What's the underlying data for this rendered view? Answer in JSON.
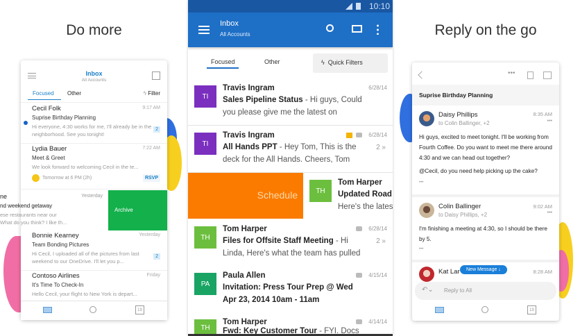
{
  "headings": {
    "left": "Do more",
    "right": "Reply on the go"
  },
  "colors": {
    "outlook_blue": "#1e6fc6",
    "archive_green": "#13b04b",
    "schedule_orange": "#fb7b00",
    "purple": "#7b2fbf",
    "green_avatar": "#6cbf3e",
    "teal_avatar": "#19a463"
  },
  "left_phone": {
    "header": {
      "title": "Inbox",
      "subtitle": "All Accounts",
      "menu_icon": "hamburger-icon",
      "compose_icon": "compose-icon"
    },
    "tabs": [
      {
        "label": "Focused",
        "active": true
      },
      {
        "label": "Other"
      }
    ],
    "filter_label": "Filter",
    "messages": [
      {
        "sender": "Cecil Folk",
        "time": "9:17 AM",
        "subject": "Suprise Birthday Planning",
        "preview": "Hi everyone, 4:30 works for me, I'll already be in the neighborhood. See you tonight!",
        "count": "2",
        "unread": true
      },
      {
        "sender": "Lydia Bauer",
        "time": "7:22 AM",
        "subject": "Meet & Greet",
        "preview": "We look forward to welcoming Cecil in the te...",
        "event": "Tomorrow at 6 PM (2h)",
        "action": "RSVP"
      },
      {
        "sender": "ne",
        "time": "Yesterday",
        "subject": "nd weekend getaway",
        "preview": "ese restaurants near our\nWhat do you think? I like th...",
        "swipe_action": "Archive"
      },
      {
        "sender": "Bonnie Kearney",
        "time": "Yesterday",
        "subject": "Team Bonding Pictures",
        "preview": "Hi Cecil, I uploaded all of the pictures from last weekend to our OneDrive. I'll let you p...",
        "count": "2"
      },
      {
        "sender": "Contoso Airlines",
        "time": "Friday",
        "subject": "It's Time To Check-In",
        "preview": "Hello Cecil, your flight to New York is depart..."
      }
    ],
    "nav": {
      "calendar_day": "19"
    }
  },
  "center_phone": {
    "status": {
      "time": "10:10"
    },
    "header": {
      "title": "Inbox",
      "subtitle": "All Accounts"
    },
    "tabs": [
      {
        "label": "Focused",
        "active": true
      },
      {
        "label": "Other"
      }
    ],
    "quick_filters": "Quick Filters",
    "messages": [
      {
        "initials": "TI",
        "sender": "Travis Ingram",
        "subject": "Sales Pipeline Status",
        "preview1": " - Hi guys, Could",
        "preview2": "you please give me the latest on",
        "date": "6/28/14"
      },
      {
        "initials": "TI",
        "sender": "Travis Ingram",
        "subject": "All Hands PPT",
        "preview1": " - Hey Tom, This is the",
        "preview2": "deck for the All Hands. Cheers, Tom",
        "date": "6/28/14",
        "count": "2",
        "flagged": true
      },
      {
        "initials": "TH",
        "sender": "Tom Harper",
        "subject": "Updated Road",
        "preview2": "Here's the lates",
        "swipe_action": "Schedule"
      },
      {
        "initials": "TH",
        "sender": "Tom Harper",
        "subject": "Files for Offsite Staff Meeting",
        "preview1": " - Hi",
        "preview2": "Linda, Here's what the team has pulled",
        "date": "6/28/14",
        "count": "2"
      },
      {
        "initials": "PA",
        "sender": "Paula Allen",
        "subject": "Invitation: Press Tour Prep @ Wed",
        "preview2": "Apr 23, 2014 10am - 11am",
        "date": "4/15/14"
      },
      {
        "initials": "TH",
        "sender": "Tom Harper",
        "subject": "Fwd: Key Customer Tour",
        "preview1": " - FYI. Docs",
        "date": "4/14/14"
      }
    ]
  },
  "right_phone": {
    "subject": "Suprise Birthday Planning",
    "messages": [
      {
        "sender": "Daisy Phillips",
        "to": "to Colin Ballinger, +2",
        "time": "8:35 AM",
        "body": "Hi guys, excited to meet tonight. I'll be working from Fourth Coffee. Do you want to meet me there around 4:30 and we can head out together?",
        "body2": "@Cecil, do you need help picking up the cake?"
      },
      {
        "sender": "Colin Ballinger",
        "to": "to Daisy Phillips, +2",
        "time": "9:02 AM",
        "body": "I'm finishing a meeting at 4:30, so I should be there by 5."
      },
      {
        "sender": "Kat Lar",
        "time": "8:28 AM"
      }
    ],
    "new_message": "New Message ↓",
    "reply_placeholder": "Reply to All",
    "nav": {
      "calendar_day": "19"
    }
  }
}
